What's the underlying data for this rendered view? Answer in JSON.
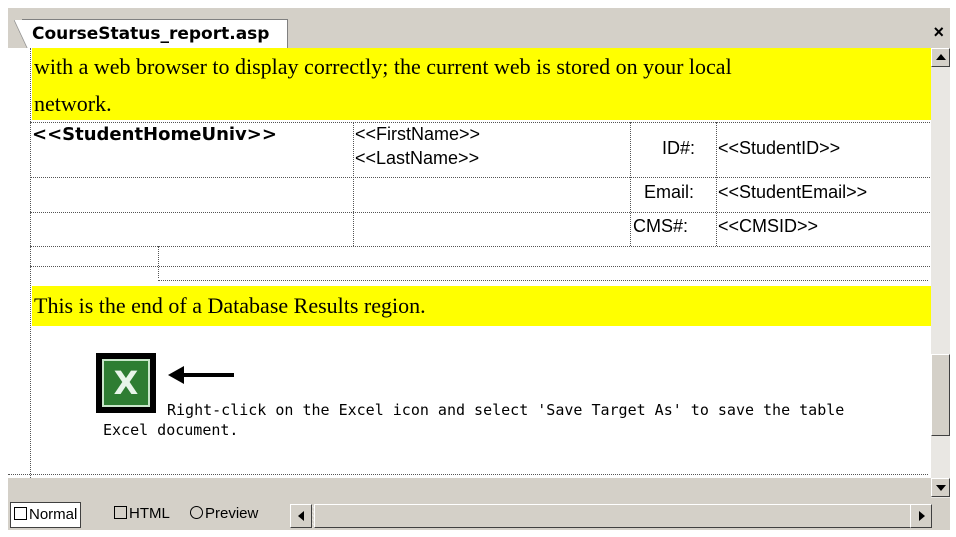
{
  "document_tab": {
    "label": "CourseStatus_report.asp"
  },
  "close_glyph": "×",
  "banner_top": {
    "line1": "with a web browser to display correctly; the current web is stored on your local",
    "line2": "network."
  },
  "table": {
    "row1": {
      "home_univ": "<<StudentHomeUniv>>",
      "first_name": "<<FirstName>>",
      "last_name": "<<LastName>>",
      "label": "ID#:",
      "value": "<<StudentID>>"
    },
    "row2": {
      "label": "Email:",
      "value": "<<StudentEmail>>"
    },
    "row3": {
      "label": "CMS#:",
      "value": "<<CMSID>>"
    }
  },
  "banner_end": "This is the end of a Database Results region.",
  "excel": {
    "icon": "excel-icon",
    "glyph": "X",
    "note_line1": "Right-click on the Excel icon and select 'Save Target As' to save the table",
    "note_line2": "Excel document."
  },
  "view_tabs": [
    {
      "label": "Normal",
      "icon": "normal-view-icon"
    },
    {
      "label": "HTML",
      "icon": "html-view-icon"
    },
    {
      "label": "Preview",
      "icon": "preview-view-icon"
    }
  ],
  "colors": {
    "highlight": "#ffff00",
    "chrome": "#d4d0c8",
    "excel_green": "#2e7d32"
  }
}
